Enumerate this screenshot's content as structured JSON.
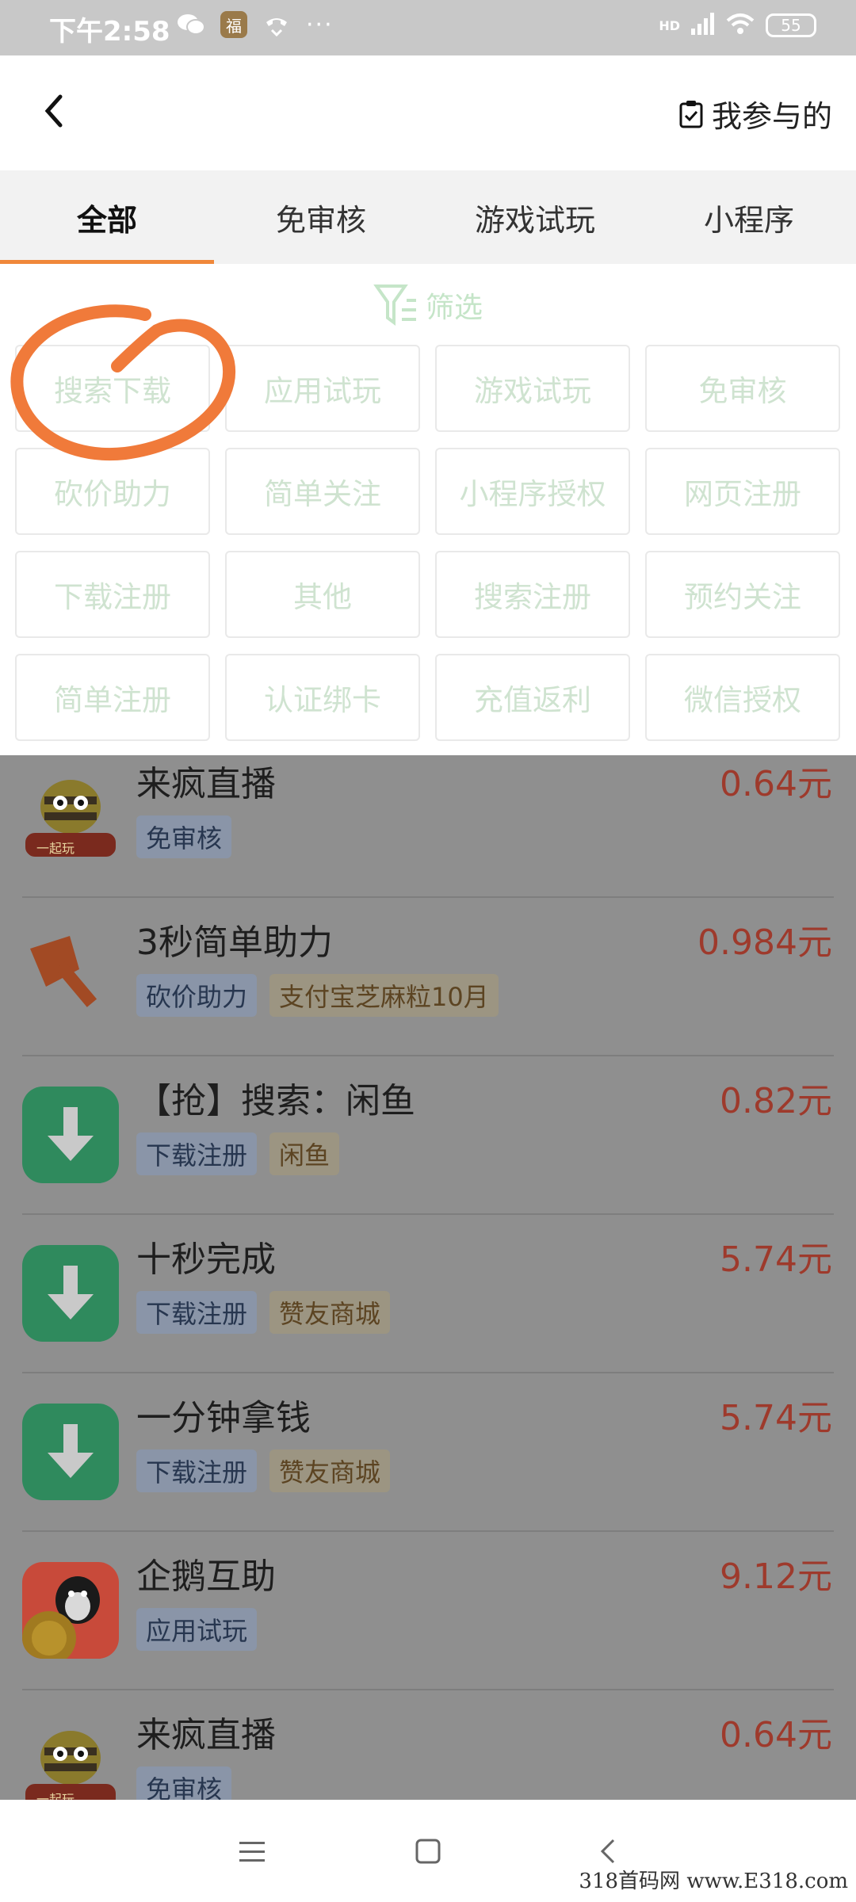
{
  "status_bar": {
    "time": "下午2:58",
    "fu_badge": "福",
    "dots": "···",
    "network": "HD",
    "battery": "55",
    "icons": [
      "wechat-icon",
      "fu-icon",
      "phone-icon",
      "more-icon",
      "signal-icon",
      "wifi-icon",
      "battery-icon"
    ]
  },
  "header": {
    "back_icon": "back-chevron-icon",
    "mine_label": "我参与的",
    "mine_icon": "clipboard-check-icon"
  },
  "tabs": [
    {
      "label": "全部",
      "active": true
    },
    {
      "label": "免审核",
      "active": false
    },
    {
      "label": "游戏试玩",
      "active": false
    },
    {
      "label": "小程序",
      "active": false
    }
  ],
  "filter": {
    "label": "筛选",
    "icon": "filter-icon",
    "options": [
      "搜索下载",
      "应用试玩",
      "游戏试玩",
      "免审核",
      "砍价助力",
      "简单关注",
      "小程序授权",
      "网页注册",
      "下载注册",
      "其他",
      "搜索注册",
      "预约关注",
      "简单注册",
      "认证绑卡",
      "充值返利",
      "微信授权"
    ]
  },
  "tasks": [
    {
      "title": "来疯直播",
      "tags": [
        {
          "text": "免审核",
          "kind": "blue"
        }
      ],
      "price": "0.64元",
      "icon": "bee-icon"
    },
    {
      "title": "3秒简单助力",
      "tags": [
        {
          "text": "砍价助力",
          "kind": "blue"
        },
        {
          "text": "支付宝芝麻粒10月",
          "kind": "amber"
        }
      ],
      "price": "0.984元",
      "icon": "axe-icon"
    },
    {
      "title": "【抢】搜索：闲鱼",
      "tags": [
        {
          "text": "下载注册",
          "kind": "blue"
        },
        {
          "text": "闲鱼",
          "kind": "amber"
        }
      ],
      "price": "0.82元",
      "icon": "download-icon"
    },
    {
      "title": "十秒完成",
      "tags": [
        {
          "text": "下载注册",
          "kind": "blue"
        },
        {
          "text": "赞友商城",
          "kind": "amber"
        }
      ],
      "price": "5.74元",
      "icon": "download-icon"
    },
    {
      "title": "一分钟拿钱",
      "tags": [
        {
          "text": "下载注册",
          "kind": "blue"
        },
        {
          "text": "赞友商城",
          "kind": "amber"
        }
      ],
      "price": "5.74元",
      "icon": "download-icon"
    },
    {
      "title": "企鹅互助",
      "tags": [
        {
          "text": "应用试玩",
          "kind": "blue"
        }
      ],
      "price": "9.12元",
      "icon": "penguin-icon"
    },
    {
      "title": "来疯直播",
      "tags": [
        {
          "text": "免审核",
          "kind": "blue"
        }
      ],
      "price": "0.64元",
      "icon": "bee-icon"
    }
  ],
  "bee_badge": "一起玩",
  "nav": {
    "icons": [
      "menu-icon",
      "home-icon",
      "back-icon"
    ]
  },
  "watermark": "318首码网 www.E318.com",
  "colors": {
    "accent": "#f0883a",
    "price": "#9e3a2c",
    "filter_text": "#cfe3d0",
    "overlay": "#8f8f8f"
  }
}
